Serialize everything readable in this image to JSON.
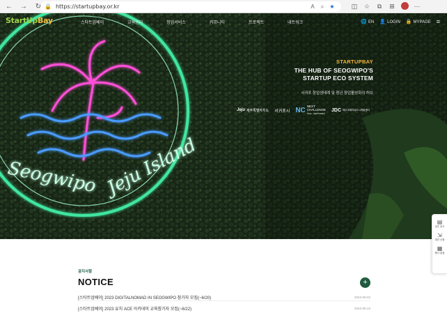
{
  "browser": {
    "url": "https://startupbay.or.kr",
    "nav_icons": [
      "back-icon",
      "forward-icon",
      "refresh-icon"
    ],
    "right_icons": [
      "read-aloud-icon",
      "zoom-icon",
      "favorite-star-icon",
      "split-screen-icon",
      "favorites-icon",
      "collections-icon",
      "extensions-icon",
      "profile-icon",
      "more-icon"
    ]
  },
  "header": {
    "logo_start": "StartUp",
    "logo_end": "Bay",
    "menu": [
      "스타트업베이",
      "교육센터",
      "창업서비스",
      "커뮤니티",
      "프로젝트",
      "네트워크"
    ],
    "language": "EN",
    "login": "LOGIN",
    "mypage": "MYPAGE"
  },
  "hero": {
    "brand": "STARTUPBAY",
    "title_line1": "THE HUB OF SEOGWIPO'S",
    "title_line2": "STARTUP ECO SYSTEM",
    "subtitle": "서귀포 창업생태계 및 청년 창업활성화의 허브",
    "neon_text": "Seogwipo Jeju Island",
    "partners": {
      "jeju": "Jeju",
      "jeju_sub": "제주특별자치도",
      "seogwipo": "서귀포시",
      "nc_logo": "NC",
      "nc_line1": "NEXT",
      "nc_line2": "CHALLENGE",
      "nc_line3": "ASIA · VENTURES",
      "jdc": "JDC",
      "jdc_sub": "제주국제자유도시개발센터"
    }
  },
  "notice": {
    "eyebrow": "공지사항",
    "title": "NOTICE",
    "more": "+",
    "items": [
      {
        "title": "[스타트업베이] 2023 DIGITALNOMAD IN SEOGWIPO 참가자 모집(~6/20)",
        "date": "2023-06-02"
      },
      {
        "title": "[스타트업베이] 2023 유치 ACE 아카데미 교육참가자 모집(~6/22)",
        "date": "2023-06-23"
      }
    ]
  },
  "quick_bar": {
    "items": [
      {
        "icon": "document-icon",
        "label": "입주 공고"
      },
      {
        "icon": "arrows-icon",
        "label": "대관 신청"
      },
      {
        "icon": "calendar-icon",
        "label": "행사 일정"
      }
    ]
  }
}
